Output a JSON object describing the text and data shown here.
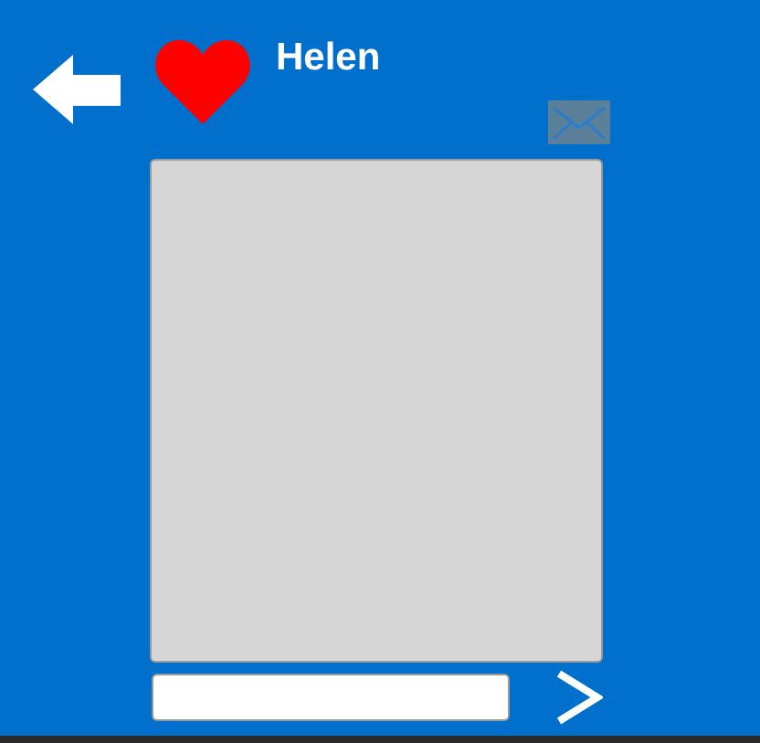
{
  "contact": {
    "name": "Helen",
    "favorite": true
  }
}
